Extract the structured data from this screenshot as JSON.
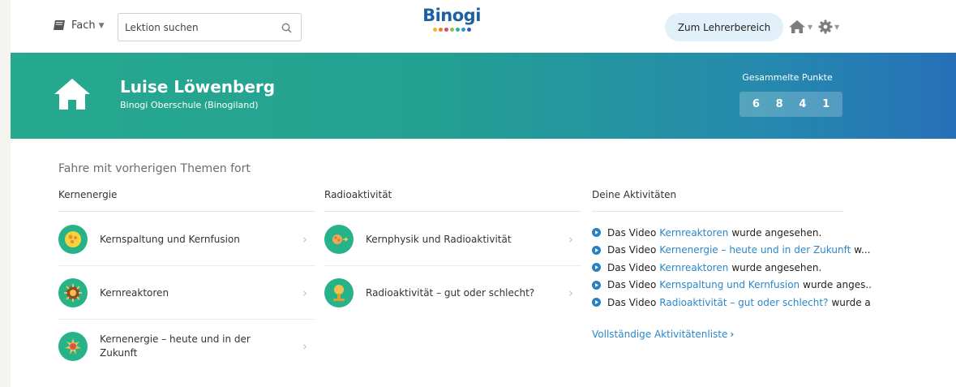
{
  "header": {
    "subject_label": "Fach",
    "search_placeholder": "Lektion suchen",
    "logo_text": "Binogi",
    "logo_dot_colors": [
      "#f2b632",
      "#f07d2a",
      "#e5407c",
      "#8ac43f",
      "#2bb6a0",
      "#3a8fd8",
      "#2a5fb8"
    ],
    "teacher_button": "Zum Lehrerbereich"
  },
  "profile": {
    "name": "Luise Löwenberg",
    "school": "Binogi Oberschule (Binogiland)",
    "points_label": "Gesammelte Punkte",
    "points_digits": [
      "6",
      "8",
      "4",
      "1"
    ]
  },
  "continue_title": "Fahre mit vorherigen Themen fort",
  "columns": [
    {
      "title": "Kernenergie",
      "topics": [
        "Kernspaltung und Kernfusion",
        "Kernreaktoren",
        "Kernenergie – heute und in der Zukunft"
      ]
    },
    {
      "title": "Radioaktivität",
      "topics": [
        "Kernphysik und Radioaktivität",
        "Radioaktivität – gut oder schlecht?"
      ]
    }
  ],
  "activities": {
    "title": "Deine Aktivitäten",
    "items": [
      {
        "prefix": "Das Video",
        "link": "Kernreaktoren",
        "suffix": "wurde angesehen."
      },
      {
        "prefix": "Das Video",
        "link": "Kernenergie – heute und in der Zukunft",
        "suffix": "w..."
      },
      {
        "prefix": "Das Video",
        "link": "Kernreaktoren",
        "suffix": "wurde angesehen."
      },
      {
        "prefix": "Das Video",
        "link": "Kernspaltung und Kernfusion",
        "suffix": "wurde anges..."
      },
      {
        "prefix": "Das Video",
        "link": "Radioaktivität – gut oder schlecht?",
        "suffix": "wurde a..."
      }
    ],
    "full_list_link": "Vollständige Aktivitätenliste"
  },
  "colors": {
    "accent": "#2a87c8",
    "topic_circle": "#26b38a",
    "banner_start": "#26a98f",
    "banner_end": "#2670b8"
  }
}
